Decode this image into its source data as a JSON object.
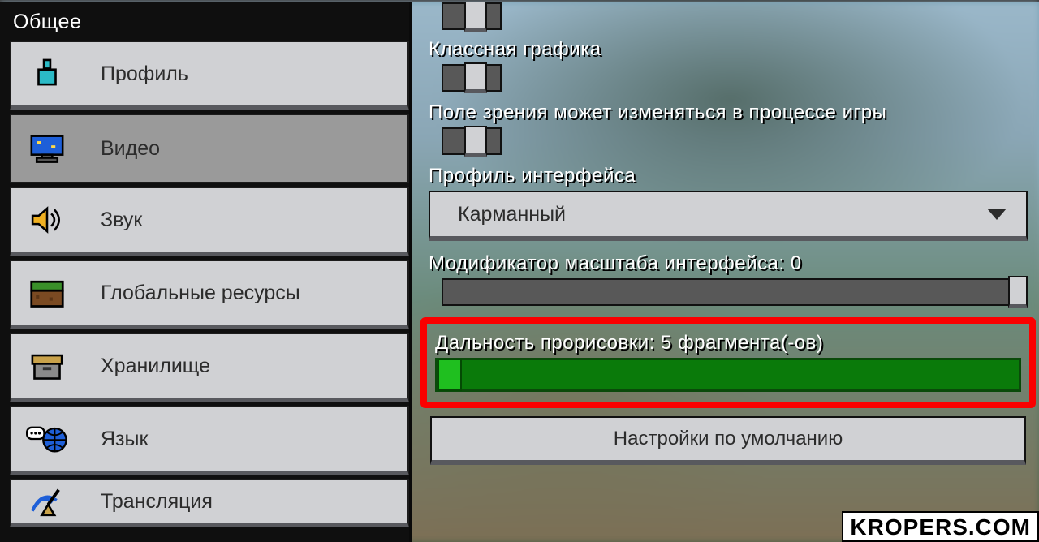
{
  "sidebar": {
    "header": "Общее",
    "items": [
      {
        "label": "Профиль",
        "icon": "profile-icon"
      },
      {
        "label": "Видео",
        "icon": "monitor-icon",
        "active": true
      },
      {
        "label": "Звук",
        "icon": "speaker-icon"
      },
      {
        "label": "Глобальные ресурсы",
        "icon": "grass-block-icon"
      },
      {
        "label": "Хранилище",
        "icon": "archive-icon"
      },
      {
        "label": "Язык",
        "icon": "globe-chat-icon"
      },
      {
        "label": "Трансляция",
        "icon": "antenna-icon"
      }
    ]
  },
  "settings": {
    "fancy_graphics_label": "Классная графика",
    "fov_can_change_label": "Поле зрения может изменяться в процессе игры",
    "ui_profile_label": "Профиль интерфейса",
    "ui_profile_value": "Карманный",
    "gui_scale_label": "Модификатор масштаба интерфейса: 0",
    "render_distance_label": "Дальность прорисовки: 5 фрагмента(-ов)",
    "defaults_button": "Настройки по умолчанию"
  },
  "watermark": "KROPERS.COM"
}
